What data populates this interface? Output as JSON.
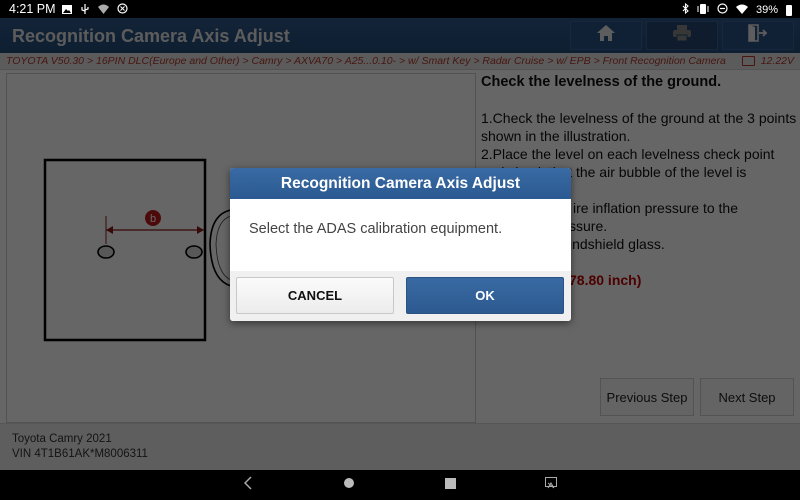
{
  "status_bar": {
    "time": "4:21 PM",
    "left_icons": [
      "image-icon",
      "usb-icon",
      "wifi-hotspot-icon",
      "sync-icon"
    ],
    "right_icons": [
      "bluetooth-icon",
      "vibrate-icon",
      "do-not-disturb-icon",
      "wifi-icon"
    ],
    "battery_percent": "39%"
  },
  "header": {
    "title": "Recognition Camera Axis Adjust",
    "buttons": [
      {
        "name": "home",
        "icon": "home-icon"
      },
      {
        "name": "print",
        "icon": "printer-icon"
      },
      {
        "name": "exit",
        "icon": "exit-icon"
      }
    ]
  },
  "breadcrumb": {
    "path": "TOYOTA V50.30 > 16PIN DLC(Europe and Other) > Camry > AXVA70 > A25...0.10- > w/ Smart Key > Radar Cruise > w/ EPB > Front Recognition Camera",
    "voltage": "12.22V"
  },
  "illustration": {
    "label": "b"
  },
  "instructions": {
    "heading": "Check the levelness of the ground.",
    "line1": "1.Check the levelness of the ground at the 3 points shown in the illustration.",
    "line2": "2.Place the level on each levelness check point and check that the air bubble of the level is",
    "line3": "ire inflation pressure to the",
    "line4": "ssure.",
    "line5": "indshield glass.",
    "warning": "78.80 inch)"
  },
  "nav_buttons": {
    "previous": "Previous Step",
    "next": "Next Step"
  },
  "footer": {
    "vehicle": "Toyota Camry 2021",
    "vin": "VIN 4T1B61AK*M8006311"
  },
  "dialog": {
    "title": "Recognition Camera Axis Adjust",
    "message": "Select the ADAS calibration equipment.",
    "cancel_label": "CANCEL",
    "ok_label": "OK"
  },
  "system_nav": [
    "back-icon",
    "home-icon",
    "recents-icon",
    "screenshot-icon"
  ]
}
